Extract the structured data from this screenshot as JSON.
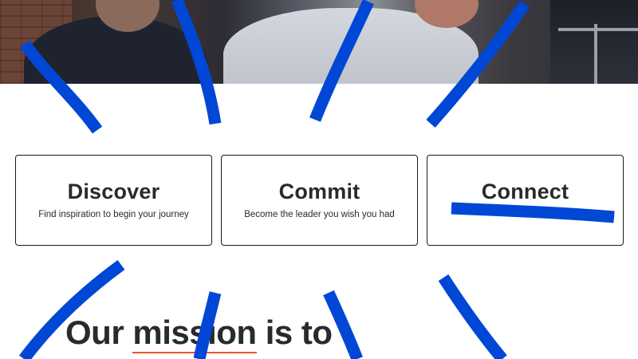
{
  "hero": {
    "image_description": "photo of people seated in a meeting room"
  },
  "cards": [
    {
      "title": "Discover",
      "description": "Find inspiration to begin your journey"
    },
    {
      "title": "Commit",
      "description": "Become the leader you wish you had"
    },
    {
      "title": "Connect",
      "description": ""
    }
  ],
  "mission": {
    "word1": "Our",
    "highlight": "mission",
    "rest": "is to",
    "line2": ""
  },
  "colors": {
    "accent_stroke": "#0047d6",
    "underline": "#e8562a",
    "text": "#2a2a2a",
    "card_border": "#1a1a1a"
  }
}
